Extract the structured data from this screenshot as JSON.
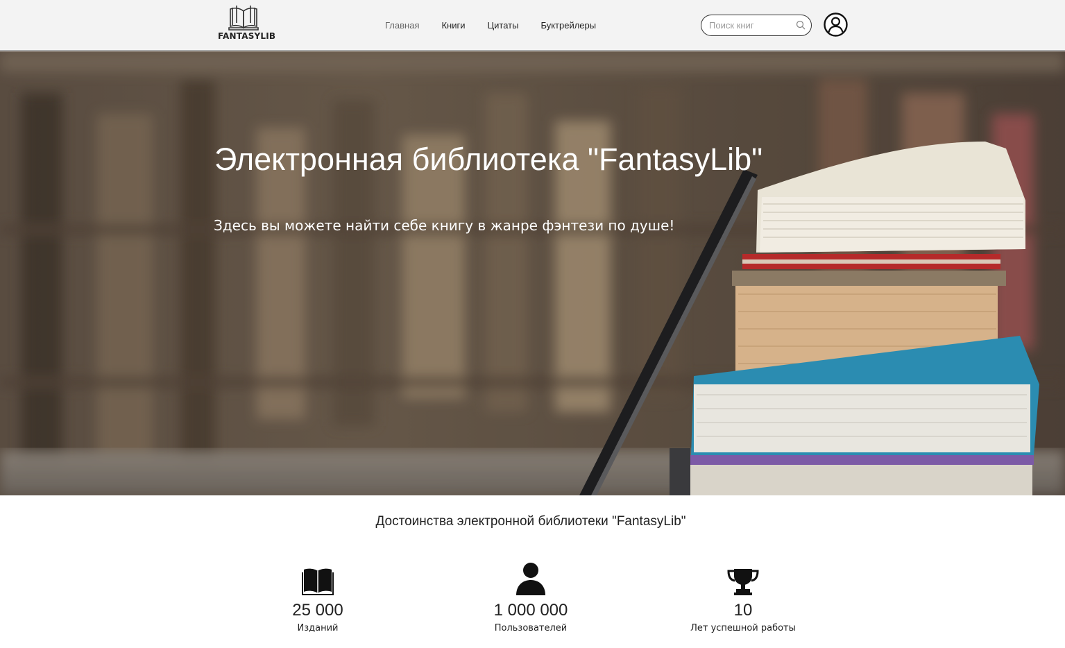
{
  "header": {
    "logo_text": "FANTASYLIB",
    "nav": [
      {
        "label": "Главная"
      },
      {
        "label": "Книги"
      },
      {
        "label": "Цитаты"
      },
      {
        "label": "Буктрейлеры"
      }
    ],
    "search": {
      "placeholder": "Поиск книг",
      "value": ""
    }
  },
  "hero": {
    "title": "Электронная библиотека \"FantasyLib\"",
    "subtitle": "Здесь вы можете найти себе книгу в жанре фэнтези по душе!"
  },
  "advantages": {
    "title": "Достоинства электронной библиотеки \"FantasyLib\"",
    "items": [
      {
        "icon": "open-book-icon",
        "number": "25 000",
        "label": "Изданий"
      },
      {
        "icon": "user-icon",
        "number": "1 000 000",
        "label": "Пользователей"
      },
      {
        "icon": "trophy-icon",
        "number": "10",
        "label": "Лет успешной работы"
      }
    ]
  },
  "colors": {
    "header_bg": "#f3f3f3",
    "text": "#222222",
    "nav_active": "#666666"
  }
}
